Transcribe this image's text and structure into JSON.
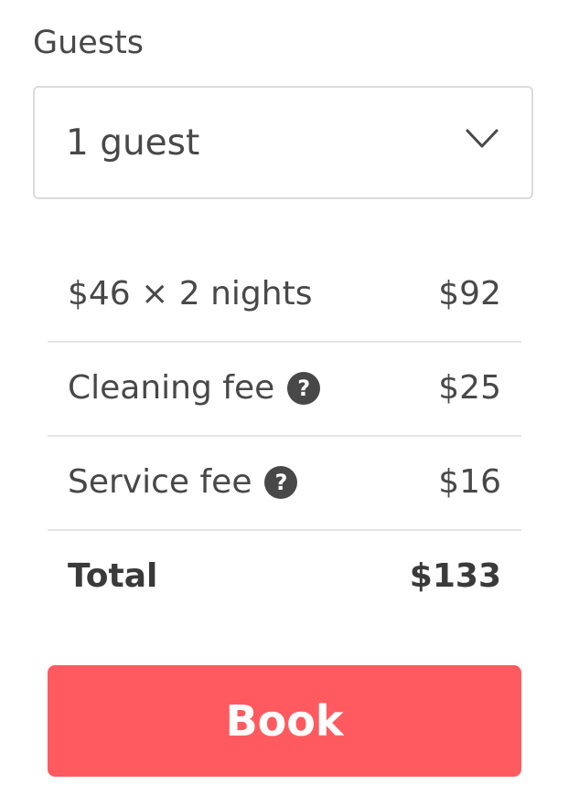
{
  "guests": {
    "label": "Guests",
    "selected": "1 guest"
  },
  "pricing": {
    "rows": [
      {
        "label": "$46 × 2 nights",
        "value": "$92"
      },
      {
        "label": "Cleaning fee",
        "value": "$25",
        "help_icon": "question-circle-icon"
      },
      {
        "label": "Service fee",
        "value": "$16",
        "help_icon": "question-circle-icon"
      }
    ],
    "total": {
      "label": "Total",
      "value": "$133"
    }
  },
  "book": {
    "label": "Book"
  },
  "colors": {
    "accent": "#ff5a5f",
    "text": "#484848",
    "border": "#dbdbdb"
  },
  "icons": {
    "dropdown": "chevron-down-icon",
    "help": "question-circle-icon"
  }
}
